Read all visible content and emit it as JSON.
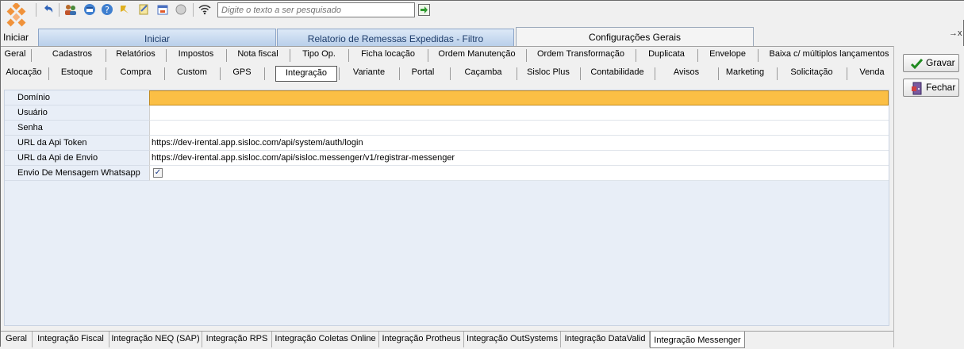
{
  "toolbar": {
    "search_placeholder": "Digite o texto a ser pesquisado",
    "search_value": "",
    "start_label": "Iniciar"
  },
  "module_tabs": [
    {
      "label": "Iniciar",
      "active": false
    },
    {
      "label": "Relatorio de Remessas Expedidas - Filtro",
      "active": false
    },
    {
      "label": "Configurações Gerais",
      "active": true
    }
  ],
  "tab_overflow": "→x",
  "section_tabs_row1": [
    "Geral",
    "Cadastros",
    "Relatórios",
    "Impostos",
    "Nota fiscal",
    "Tipo Op.",
    "Ficha locação",
    "Ordem Manutenção",
    "Ordem Transformação",
    "Duplicata",
    "Envelope",
    "Baixa c/ múltiplos lançamentos"
  ],
  "section_tabs_row2": [
    "Alocação",
    "Estoque",
    "Compra",
    "Custom",
    "GPS",
    "Integração",
    "Variante",
    "Portal",
    "Caçamba",
    "Sisloc Plus",
    "Contabilidade",
    "Avisos",
    "Marketing",
    "Solicitação",
    "Venda"
  ],
  "selected_section": "Integração",
  "properties": [
    {
      "label": "Domínio",
      "value": "",
      "focused": true
    },
    {
      "label": "Usuário",
      "value": ""
    },
    {
      "label": "Senha",
      "value": ""
    },
    {
      "label": "URL da Api Token",
      "value": "https://dev-irental.app.sisloc.com/api/system/auth/login"
    },
    {
      "label": "URL da Api de Envio",
      "value": "https://dev-irental.app.sisloc.com/api/sisloc.messenger/v1/registrar-messenger"
    },
    {
      "label": "Envio De Mensagem Whatsapp",
      "checkbox": true,
      "checked": true,
      "check_glyph": "✓"
    }
  ],
  "bottom_tabs": [
    "Geral",
    "Integração Fiscal",
    "Integração NEQ (SAP)",
    "Integração RPS",
    "Integração Coletas Online",
    "Integração Protheus",
    "Integração OutSystems",
    "Integração DataValid",
    "Integração Messenger"
  ],
  "active_bottom_tab": "Integração Messenger",
  "actions": {
    "save_label": "Gravar",
    "close_label": "Fechar"
  },
  "colors": {
    "focused_field": "#fbbf45",
    "grid_bg": "#e8eef7",
    "tab_gradient_top": "#dde9f7",
    "tab_text": "#1e3d6b"
  }
}
